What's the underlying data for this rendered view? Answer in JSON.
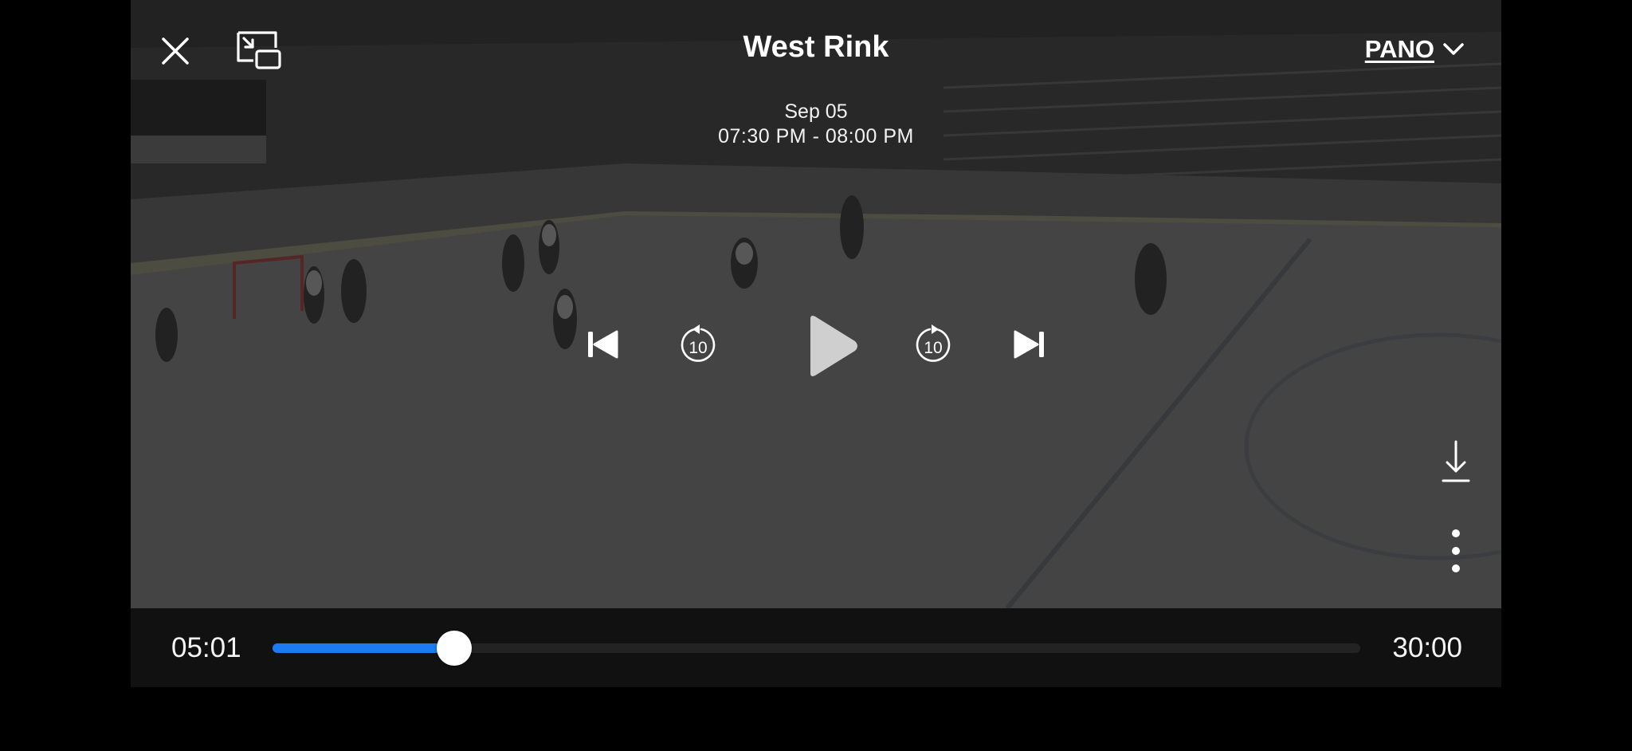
{
  "header": {
    "title": "West Rink",
    "date": "Sep 05",
    "time_range": "07:30 PM - 08:00 PM",
    "view_label": "PANO"
  },
  "controls": {
    "close_icon": "close-icon",
    "pip_icon": "picture-in-picture-icon",
    "skip_previous_icon": "skip-previous-icon",
    "rewind_10_label": "10",
    "play_icon": "play-icon",
    "forward_10_label": "10",
    "skip_next_icon": "skip-next-icon",
    "download_icon": "download-icon",
    "more_icon": "more-vertical-icon"
  },
  "progress": {
    "elapsed": "05:01",
    "total": "30:00",
    "fraction": 0.1672
  },
  "colors": {
    "accent": "#1a7cf0",
    "bar_background": "#111111"
  }
}
